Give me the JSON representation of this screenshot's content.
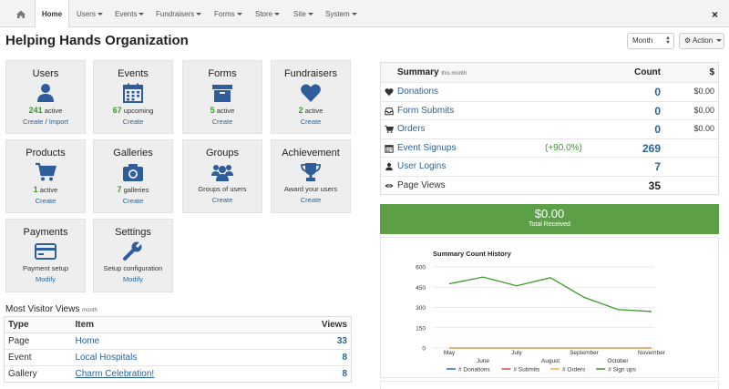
{
  "nav": {
    "items": [
      "Home",
      "Users",
      "Events",
      "Fundraisers",
      "Forms",
      "Store",
      "Site",
      "System"
    ],
    "close": "×"
  },
  "header": {
    "title": "Helping Hands Organization",
    "period": "Month",
    "action": "Action"
  },
  "tiles": {
    "users": {
      "title": "Users",
      "count": "241",
      "stat": "active",
      "link1": "Create",
      "sep": " / ",
      "link2": "Import"
    },
    "events": {
      "title": "Events",
      "count": "67",
      "stat": "upcoming",
      "link": "Create"
    },
    "forms": {
      "title": "Forms",
      "count": "5",
      "stat": "active",
      "link": "Create"
    },
    "fundraisers": {
      "title": "Fundraisers",
      "count": "2",
      "stat": "active",
      "link": "Create"
    },
    "products": {
      "title": "Products",
      "count": "1",
      "stat": "active",
      "link": "Create"
    },
    "galleries": {
      "title": "Galleries",
      "count": "7",
      "stat": "galleries",
      "link": "Create"
    },
    "groups": {
      "title": "Groups",
      "stat": "Groups of users",
      "link": "Create"
    },
    "achievement": {
      "title": "Achievement",
      "stat": "Award your users",
      "link": "Create"
    },
    "payments": {
      "title": "Payments",
      "stat": "Payment setup",
      "link": "Modify"
    },
    "settings": {
      "title": "Settings",
      "stat": "Setup configuration",
      "link": "Modify"
    }
  },
  "visitor_views": {
    "title": "Most Visitor Views",
    "period": "month",
    "headers": [
      "Type",
      "Item",
      "Views"
    ],
    "rows": [
      {
        "type": "Page",
        "item": "Home",
        "views": "33"
      },
      {
        "type": "Event",
        "item": "Local Hospitals",
        "views": "8"
      },
      {
        "type": "Gallery",
        "item": "Charm Celebration!",
        "views": "8"
      }
    ]
  },
  "summary": {
    "title": "Summary",
    "period": "this month",
    "count_header": "Count",
    "money_header": "$",
    "rows": [
      {
        "label": "Donations",
        "count": "0",
        "money": "$0.00",
        "icon": "heart-icon"
      },
      {
        "label": "Form Submits",
        "count": "0",
        "money": "$0.00",
        "icon": "inbox-icon"
      },
      {
        "label": "Orders",
        "count": "0",
        "money": "$0.00",
        "icon": "cart-icon"
      },
      {
        "label": "Event Signups",
        "pct": "(+90.0%)",
        "count": "269",
        "icon": "calendar-icon"
      },
      {
        "label": "User Logins",
        "count": "7",
        "icon": "user-icon"
      },
      {
        "label": "Page Views",
        "count": "35",
        "icon": "eye-icon"
      }
    ]
  },
  "total": {
    "amount": "$0.00",
    "label": "Total Received"
  },
  "colors": {
    "accent": "#2a6496",
    "green": "#5d9f47",
    "icon": "#2e5d9c"
  },
  "chart_data": {
    "type": "line",
    "title": "Summary Count History",
    "categories": [
      "May",
      "June",
      "July",
      "August",
      "September",
      "October",
      "November"
    ],
    "ylim": [
      0,
      600
    ],
    "yticks": [
      0,
      150,
      300,
      450,
      600
    ],
    "grid": true,
    "legend_position": "bottom",
    "series": [
      {
        "name": "# Donations",
        "color": "#1f77b4",
        "values": [
          0,
          0,
          0,
          0,
          0,
          0,
          0
        ]
      },
      {
        "name": "# Submits",
        "color": "#d9534f",
        "values": [
          0,
          0,
          0,
          0,
          0,
          0,
          0
        ]
      },
      {
        "name": "# Orders",
        "color": "#f0ad4e",
        "values": [
          0,
          0,
          0,
          0,
          0,
          0,
          0
        ]
      },
      {
        "name": "# Sign ups",
        "color": "#3c9a2b",
        "values": [
          475,
          525,
          460,
          520,
          375,
          285,
          270
        ]
      }
    ]
  }
}
